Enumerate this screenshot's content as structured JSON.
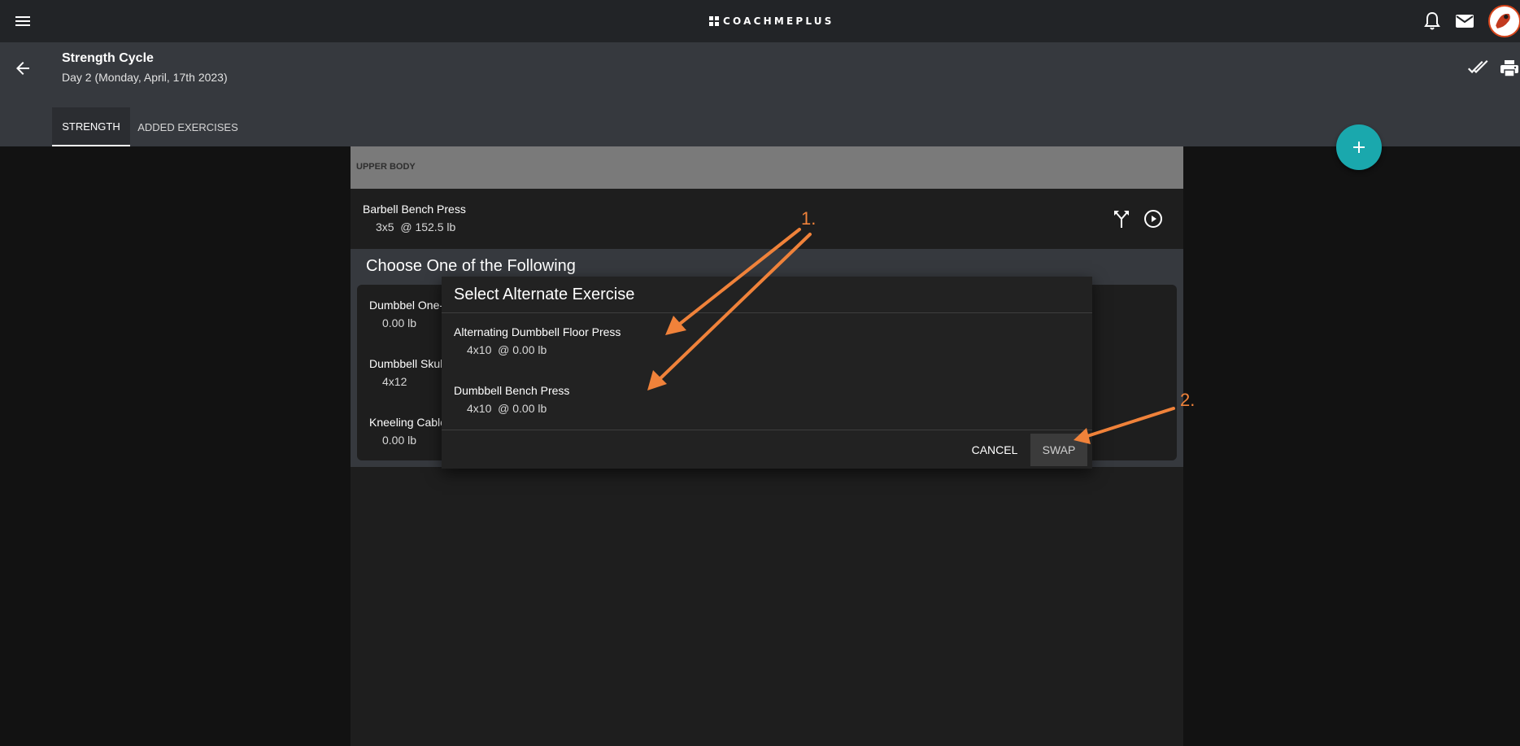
{
  "app": {
    "brand": "COACHMEPLUS"
  },
  "header": {
    "title": "Strength Cycle",
    "subtitle": "Day 2 (Monday, April, 17th 2023)",
    "tabs": [
      {
        "label": "STRENGTH",
        "active": true
      },
      {
        "label": "ADDED EXERCISES",
        "active": false
      }
    ]
  },
  "workout": {
    "section_label": "UPPER BODY",
    "main_exercise": {
      "name": "Barbell Bench Press",
      "detail": "3x5  @ 152.5 lb"
    },
    "choose_title": "Choose One of the Following",
    "choices": [
      {
        "name": "Dumbbel One-",
        "detail": "0.00 lb"
      },
      {
        "name": "Dumbbell Skul",
        "detail": "4x12"
      },
      {
        "name": "Kneeling Cable",
        "detail": "0.00 lb"
      }
    ]
  },
  "dialog": {
    "title": "Select Alternate Exercise",
    "options": [
      {
        "name": "Alternating Dumbbell Floor Press",
        "detail": "4x10  @ 0.00 lb"
      },
      {
        "name": "Dumbbell Bench Press",
        "detail": "4x10  @ 0.00 lb"
      }
    ],
    "cancel_label": "CANCEL",
    "swap_label": "SWAP"
  },
  "annotations": {
    "step1": "1.",
    "step2": "2.",
    "color": "#f0823a"
  },
  "colors": {
    "accent": "#1aa8ad",
    "topbar": "#222427",
    "header": "#36393e"
  },
  "icons": [
    "menu-icon",
    "bell-icon",
    "mail-icon",
    "back-icon",
    "double-check-icon",
    "print-icon",
    "plus-icon",
    "alternate-icon",
    "play-circle-icon"
  ]
}
